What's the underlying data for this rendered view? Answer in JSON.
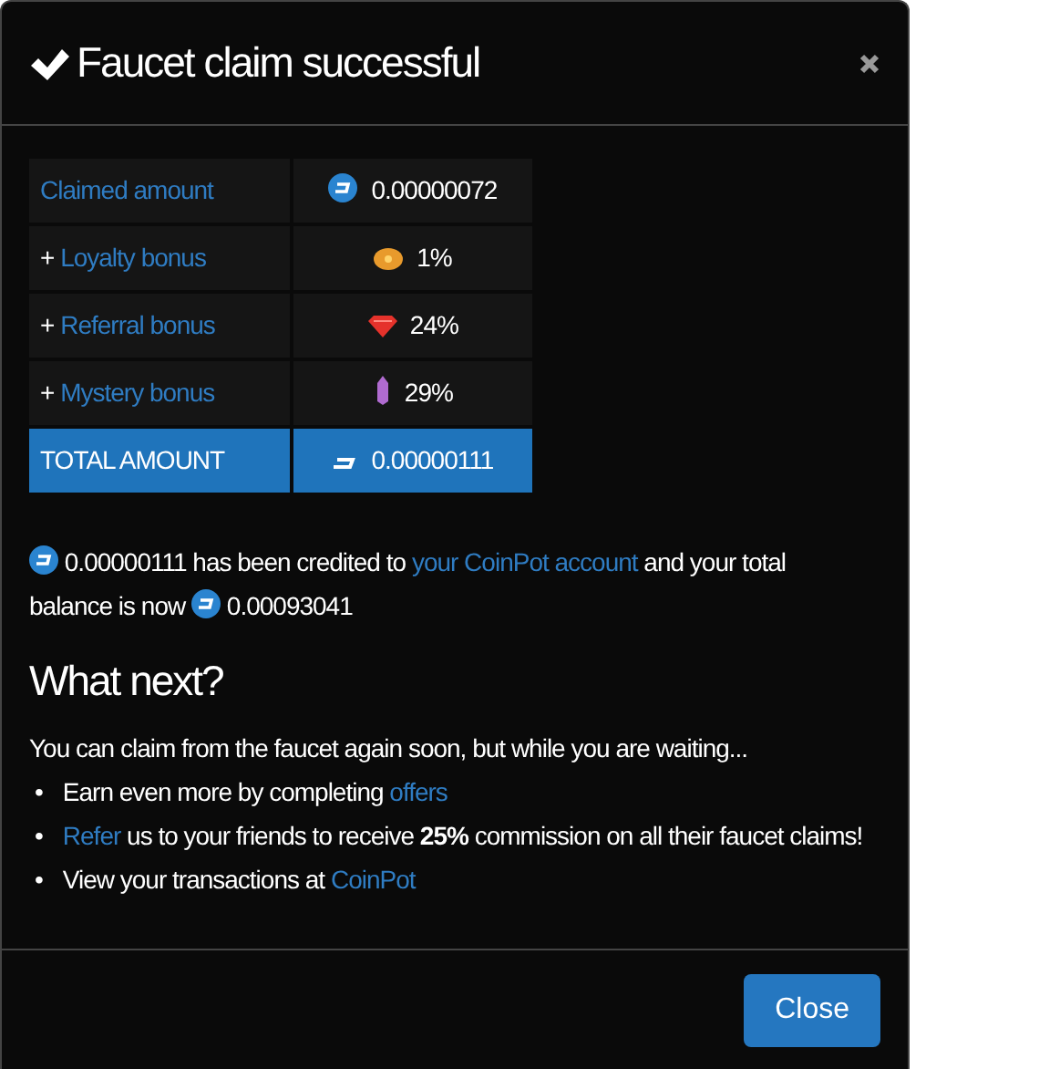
{
  "modal": {
    "title": "Faucet claim successful"
  },
  "claim_table": [
    {
      "kind": "link",
      "label": "Claimed amount",
      "value": "0.00000072"
    },
    {
      "kind": "bonus",
      "prefix": "+",
      "label": "Loyalty bonus",
      "value": "1%"
    },
    {
      "kind": "bonus",
      "prefix": "+",
      "label": "Referral bonus",
      "value": "24%"
    },
    {
      "kind": "bonus",
      "prefix": "+",
      "label": "Mystery bonus",
      "value": "29%"
    },
    {
      "kind": "total",
      "label": "TOTAL AMOUNT",
      "value": "0.00000111"
    }
  ],
  "credit_message": {
    "amount": "0.00000111",
    "text_before_link": "has been credited to",
    "link": "your CoinPot account",
    "text_after_link": "and your total balance is now",
    "balance": "0.00093041"
  },
  "what_next": {
    "heading": "What next?",
    "intro": "You can claim from the faucet again soon, but while you are waiting...",
    "bullets": [
      {
        "marker": "•",
        "segments": [
          {
            "kind": "text",
            "text": "Earn even more by completing"
          },
          {
            "kind": "link",
            "text": "offers"
          }
        ]
      },
      {
        "marker": "•",
        "segments": [
          {
            "kind": "link",
            "text": "Refer"
          },
          {
            "kind": "text",
            "text": "us to your friends to receive **25%** commission on all their faucet claims!"
          }
        ]
      },
      {
        "marker": "•",
        "segments": [
          {
            "kind": "text",
            "text": "View your transactions at"
          },
          {
            "kind": "link",
            "text": "CoinPot"
          }
        ]
      }
    ]
  },
  "footer": {
    "close_button": "Close"
  }
}
